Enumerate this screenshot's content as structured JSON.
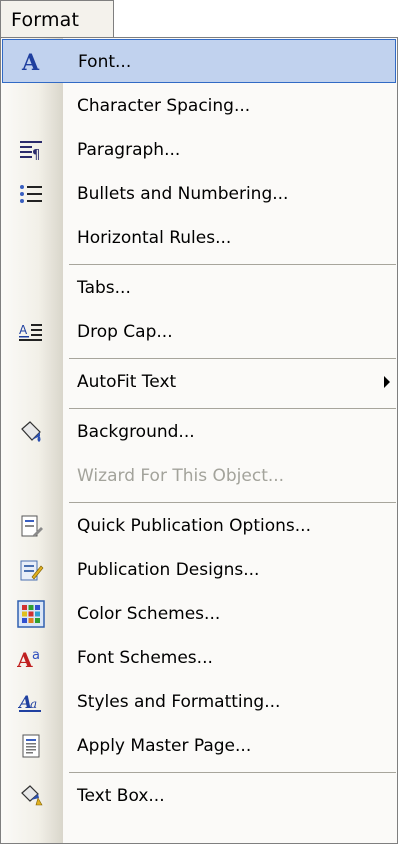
{
  "menubar": {
    "format_label": "Format"
  },
  "menu": {
    "items": [
      {
        "label": "Font...",
        "icon": "font-icon"
      },
      {
        "label": "Character Spacing...",
        "icon": ""
      },
      {
        "label": "Paragraph...",
        "icon": "paragraph-icon"
      },
      {
        "label": "Bullets and Numbering...",
        "icon": "bullets-icon"
      },
      {
        "label": "Horizontal Rules...",
        "icon": ""
      },
      {
        "label": "Tabs...",
        "icon": ""
      },
      {
        "label": "Drop Cap...",
        "icon": "drop-cap-icon"
      },
      {
        "label": "AutoFit Text",
        "icon": ""
      },
      {
        "label": "Background...",
        "icon": "paint-bucket-icon"
      },
      {
        "label": "Wizard For This Object...",
        "icon": ""
      },
      {
        "label": "Quick Publication Options...",
        "icon": "publication-options-icon"
      },
      {
        "label": "Publication Designs...",
        "icon": "publication-designs-icon"
      },
      {
        "label": "Color Schemes...",
        "icon": "color-grid-icon"
      },
      {
        "label": "Font Schemes...",
        "icon": "font-schemes-icon"
      },
      {
        "label": "Styles and Formatting...",
        "icon": "styles-icon"
      },
      {
        "label": "Apply Master Page...",
        "icon": "master-page-icon"
      },
      {
        "label": "Text Box...",
        "icon": "text-box-icon"
      }
    ]
  },
  "colors": {
    "selection_fill": "#c1d2ee",
    "selection_border": "#316ac5",
    "disabled_text": "#a3a39b"
  }
}
